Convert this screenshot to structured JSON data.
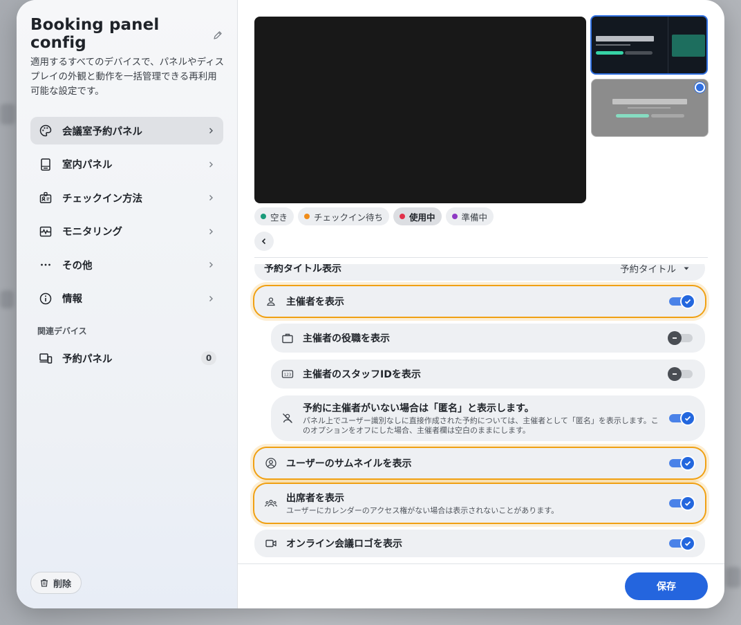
{
  "sidebar": {
    "title": "Booking panel config",
    "description": "適用するすべてのデバイスで、パネルやディスプレイの外観と動作を一括管理できる再利用可能な設定です。",
    "nav": [
      {
        "label": "会議室予約パネル",
        "icon": "palette-icon",
        "active": true
      },
      {
        "label": "室内パネル",
        "icon": "tablet-icon"
      },
      {
        "label": "チェックイン方法",
        "icon": "badge-icon"
      },
      {
        "label": "モニタリング",
        "icon": "monitoring-icon"
      },
      {
        "label": "その他",
        "icon": "more-icon"
      },
      {
        "label": "情報",
        "icon": "info-icon"
      }
    ],
    "related_label": "関連デバイス",
    "related_device": {
      "label": "予約パネル",
      "count": "0"
    },
    "delete_label": "削除"
  },
  "status_chips": [
    {
      "label": "空き",
      "color": "#1a9b7a"
    },
    {
      "label": "チェックイン待ち",
      "color": "#f08c1a"
    },
    {
      "label": "使用中",
      "color": "#e2304a",
      "active": true
    },
    {
      "label": "準備中",
      "color": "#8e3ac4"
    }
  ],
  "settings": {
    "partial_row": {
      "label": "予約タイトル表示",
      "value": "予約タイトル"
    },
    "rows": [
      {
        "label": "主催者を表示",
        "state": "on"
      },
      {
        "label": "主催者の役職を表示",
        "state": "off"
      },
      {
        "label": "主催者のスタッフIDを表示",
        "state": "off"
      },
      {
        "label": "予約に主催者がいない場合は「匿名」と表示します。",
        "sub": "パネル上でユーザー識別なしに直接作成された予約については、主催者として「匿名」を表示します。このオプションをオフにした場合、主催者欄は空白のままにします。",
        "state": "on"
      },
      {
        "label": "ユーザーのサムネイルを表示",
        "state": "on"
      },
      {
        "label": "出席者を表示",
        "sub": "ユーザーにカレンダーのアクセス権がない場合は表示されないことがあります。",
        "state": "on"
      },
      {
        "label": "オンライン会議ロゴを表示",
        "state": "on"
      }
    ]
  },
  "footer": {
    "save_label": "保存"
  },
  "colors": {
    "accent": "#2465de",
    "highlight": "#f0a012"
  }
}
